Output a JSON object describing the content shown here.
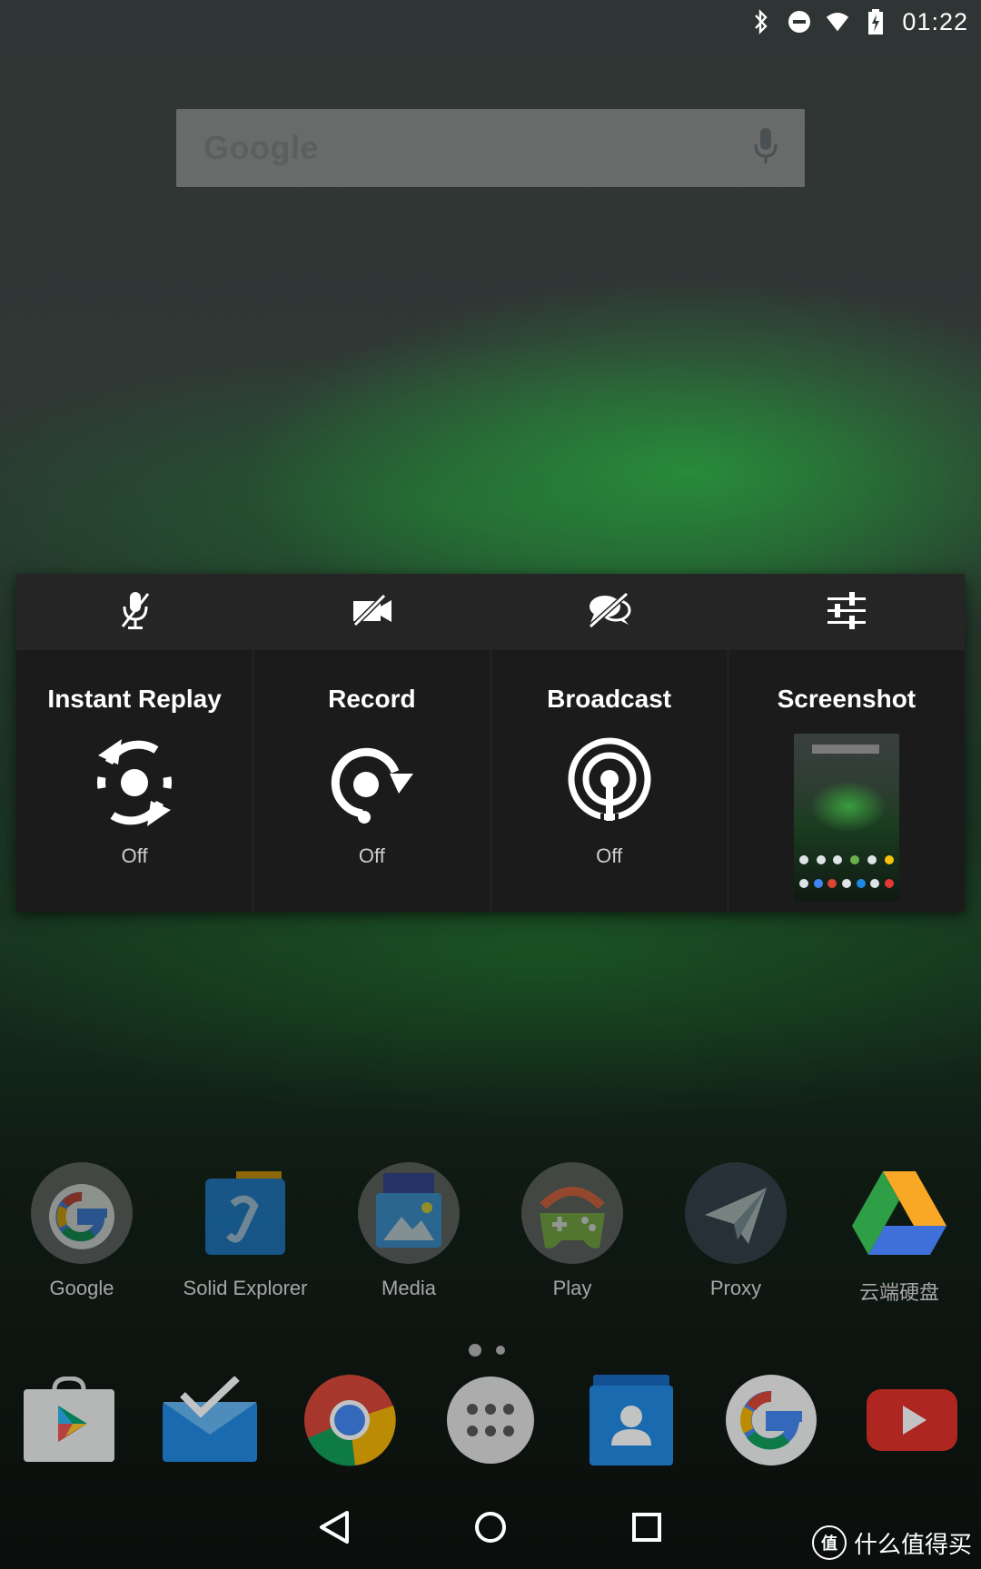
{
  "status_bar": {
    "time": "01:22",
    "icons": [
      "bluetooth-icon",
      "do-not-disturb-icon",
      "wifi-icon",
      "battery-charging-icon"
    ]
  },
  "search_widget": {
    "logo_text": "Google",
    "mic_icon": "mic-icon"
  },
  "share_overlay": {
    "toolbar": [
      {
        "name": "mic-off-icon"
      },
      {
        "name": "camera-off-icon"
      },
      {
        "name": "chat-off-icon"
      },
      {
        "name": "settings-sliders-icon"
      }
    ],
    "tiles": [
      {
        "title": "Instant Replay",
        "icon": "instant-replay-icon",
        "state": "Off"
      },
      {
        "title": "Record",
        "icon": "record-icon",
        "state": "Off"
      },
      {
        "title": "Broadcast",
        "icon": "broadcast-icon",
        "state": "Off"
      },
      {
        "title": "Screenshot",
        "icon": "screenshot-thumbnail"
      }
    ]
  },
  "apps": [
    {
      "label": "Google",
      "icon": "google-folder-icon"
    },
    {
      "label": "Solid Explorer",
      "icon": "solid-explorer-icon"
    },
    {
      "label": "Media",
      "icon": "media-folder-icon"
    },
    {
      "label": "Play",
      "icon": "play-games-icon"
    },
    {
      "label": "Proxy",
      "icon": "proxy-icon"
    },
    {
      "label": "云端硬盘",
      "icon": "drive-icon"
    }
  ],
  "dock": [
    "play-store-icon",
    "inbox-icon",
    "chrome-icon",
    "app-drawer-icon",
    "contacts-icon",
    "google-icon",
    "youtube-icon"
  ],
  "nav": [
    "back-icon",
    "home-icon",
    "recents-icon"
  ],
  "watermark": {
    "badge": "值",
    "text": "什么值得买"
  },
  "colors": {
    "overlay_bg": "#1b1b1b",
    "toolbar_bg": "#252525",
    "label": "#a6a6a6"
  }
}
